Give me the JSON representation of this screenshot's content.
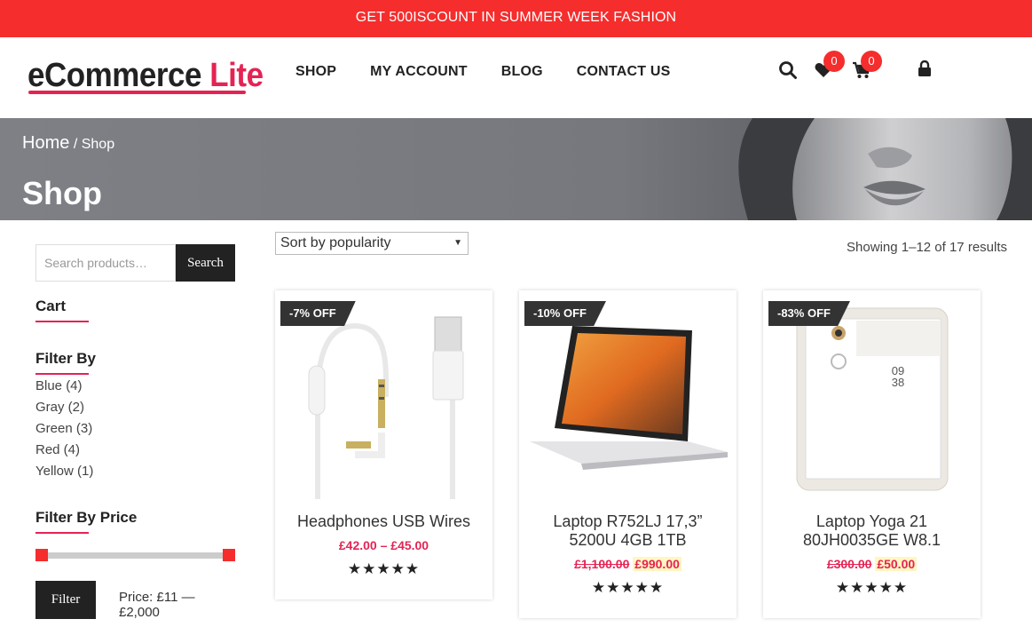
{
  "promo_bar": {
    "text": "GET 500ISCOUNT IN SUMMER WEEK FASHION"
  },
  "logo": {
    "part1": "eCommerce",
    "part2": "Lite"
  },
  "nav": {
    "items": [
      "SHOP",
      "MY ACCOUNT",
      "BLOG",
      "CONTACT US"
    ]
  },
  "header_icons": {
    "wishlist_count": "0",
    "cart_count": "0"
  },
  "hero": {
    "breadcrumb_home": "Home",
    "breadcrumb_sep": "/",
    "breadcrumb_current": "Shop",
    "title": "Shop"
  },
  "sidebar": {
    "search_placeholder": "Search products…",
    "search_button": "Search",
    "cart_title": "Cart",
    "filter_title": "Filter By",
    "filters": [
      "Blue (4)",
      "Gray (2)",
      "Green (3)",
      "Red (4)",
      "Yellow (1)"
    ],
    "price_title": "Filter By Price",
    "filter_button": "Filter",
    "price_label": "Price: £11 — £2,000",
    "price_range_fraction": [
      0,
      1
    ]
  },
  "catalog": {
    "sort_selected": "Sort by popularity",
    "showing": "Showing 1–12 of 17 results",
    "products": [
      {
        "sale": "-7% OFF",
        "name_line1": "Headphones USB Wires",
        "name_line2": "",
        "price_range": "£42.00 – £45.00",
        "old_price": "",
        "new_price": "",
        "rating": 5,
        "stars": "★★★★★"
      },
      {
        "sale": "-10% OFF",
        "name_line1": "Laptop R752LJ 17,3”",
        "name_line2": "5200U 4GB 1TB",
        "price_range": "",
        "old_price": "£1,100.00",
        "new_price": "£990.00",
        "rating": 5,
        "stars": "★★★★★"
      },
      {
        "sale": "-83% OFF",
        "name_line1": "Laptop Yoga 21",
        "name_line2": "80JH0035GE W8.1",
        "price_range": "",
        "old_price": "£300.00",
        "new_price": "£50.00",
        "rating": 5,
        "stars": "★★★★★"
      }
    ]
  },
  "phone_screen": {
    "hour": "09",
    "minute": "38"
  }
}
